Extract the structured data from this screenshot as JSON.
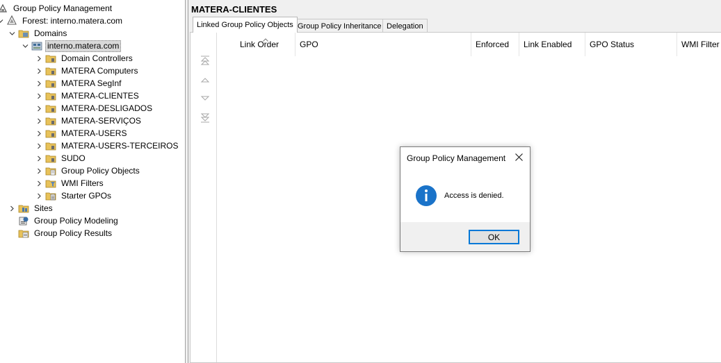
{
  "tree": {
    "root": "Group Policy Management",
    "forest": "Forest: interno.matera.com",
    "domains": "Domains",
    "domain": "interno.matera.com",
    "ous": [
      "Domain Controllers",
      "MATERA Computers",
      "MATERA SegInf",
      "MATERA-CLIENTES",
      "MATERA-DESLIGADOS",
      "MATERA-SERVIÇOS",
      "MATERA-USERS",
      "MATERA-USERS-TERCEIROS",
      "SUDO"
    ],
    "gpo_objects": "Group Policy Objects",
    "wmi_filters": "WMI Filters",
    "starter_gpos": "Starter GPOs",
    "sites": "Sites",
    "modeling": "Group Policy Modeling",
    "results": "Group Policy Results"
  },
  "content": {
    "title": "MATERA-CLIENTES",
    "tabs": [
      "Linked Group Policy Objects",
      "Group Policy Inheritance",
      "Delegation"
    ],
    "columns": [
      "Link Order",
      "GPO",
      "Enforced",
      "Link Enabled",
      "GPO Status",
      "WMI Filter"
    ]
  },
  "dialog": {
    "title": "Group Policy Management",
    "message": "Access is denied.",
    "ok": "OK"
  },
  "colors": {
    "info_icon": "#1a73c9",
    "button_focus": "#0078d7",
    "selection": "#d9d9d9"
  }
}
